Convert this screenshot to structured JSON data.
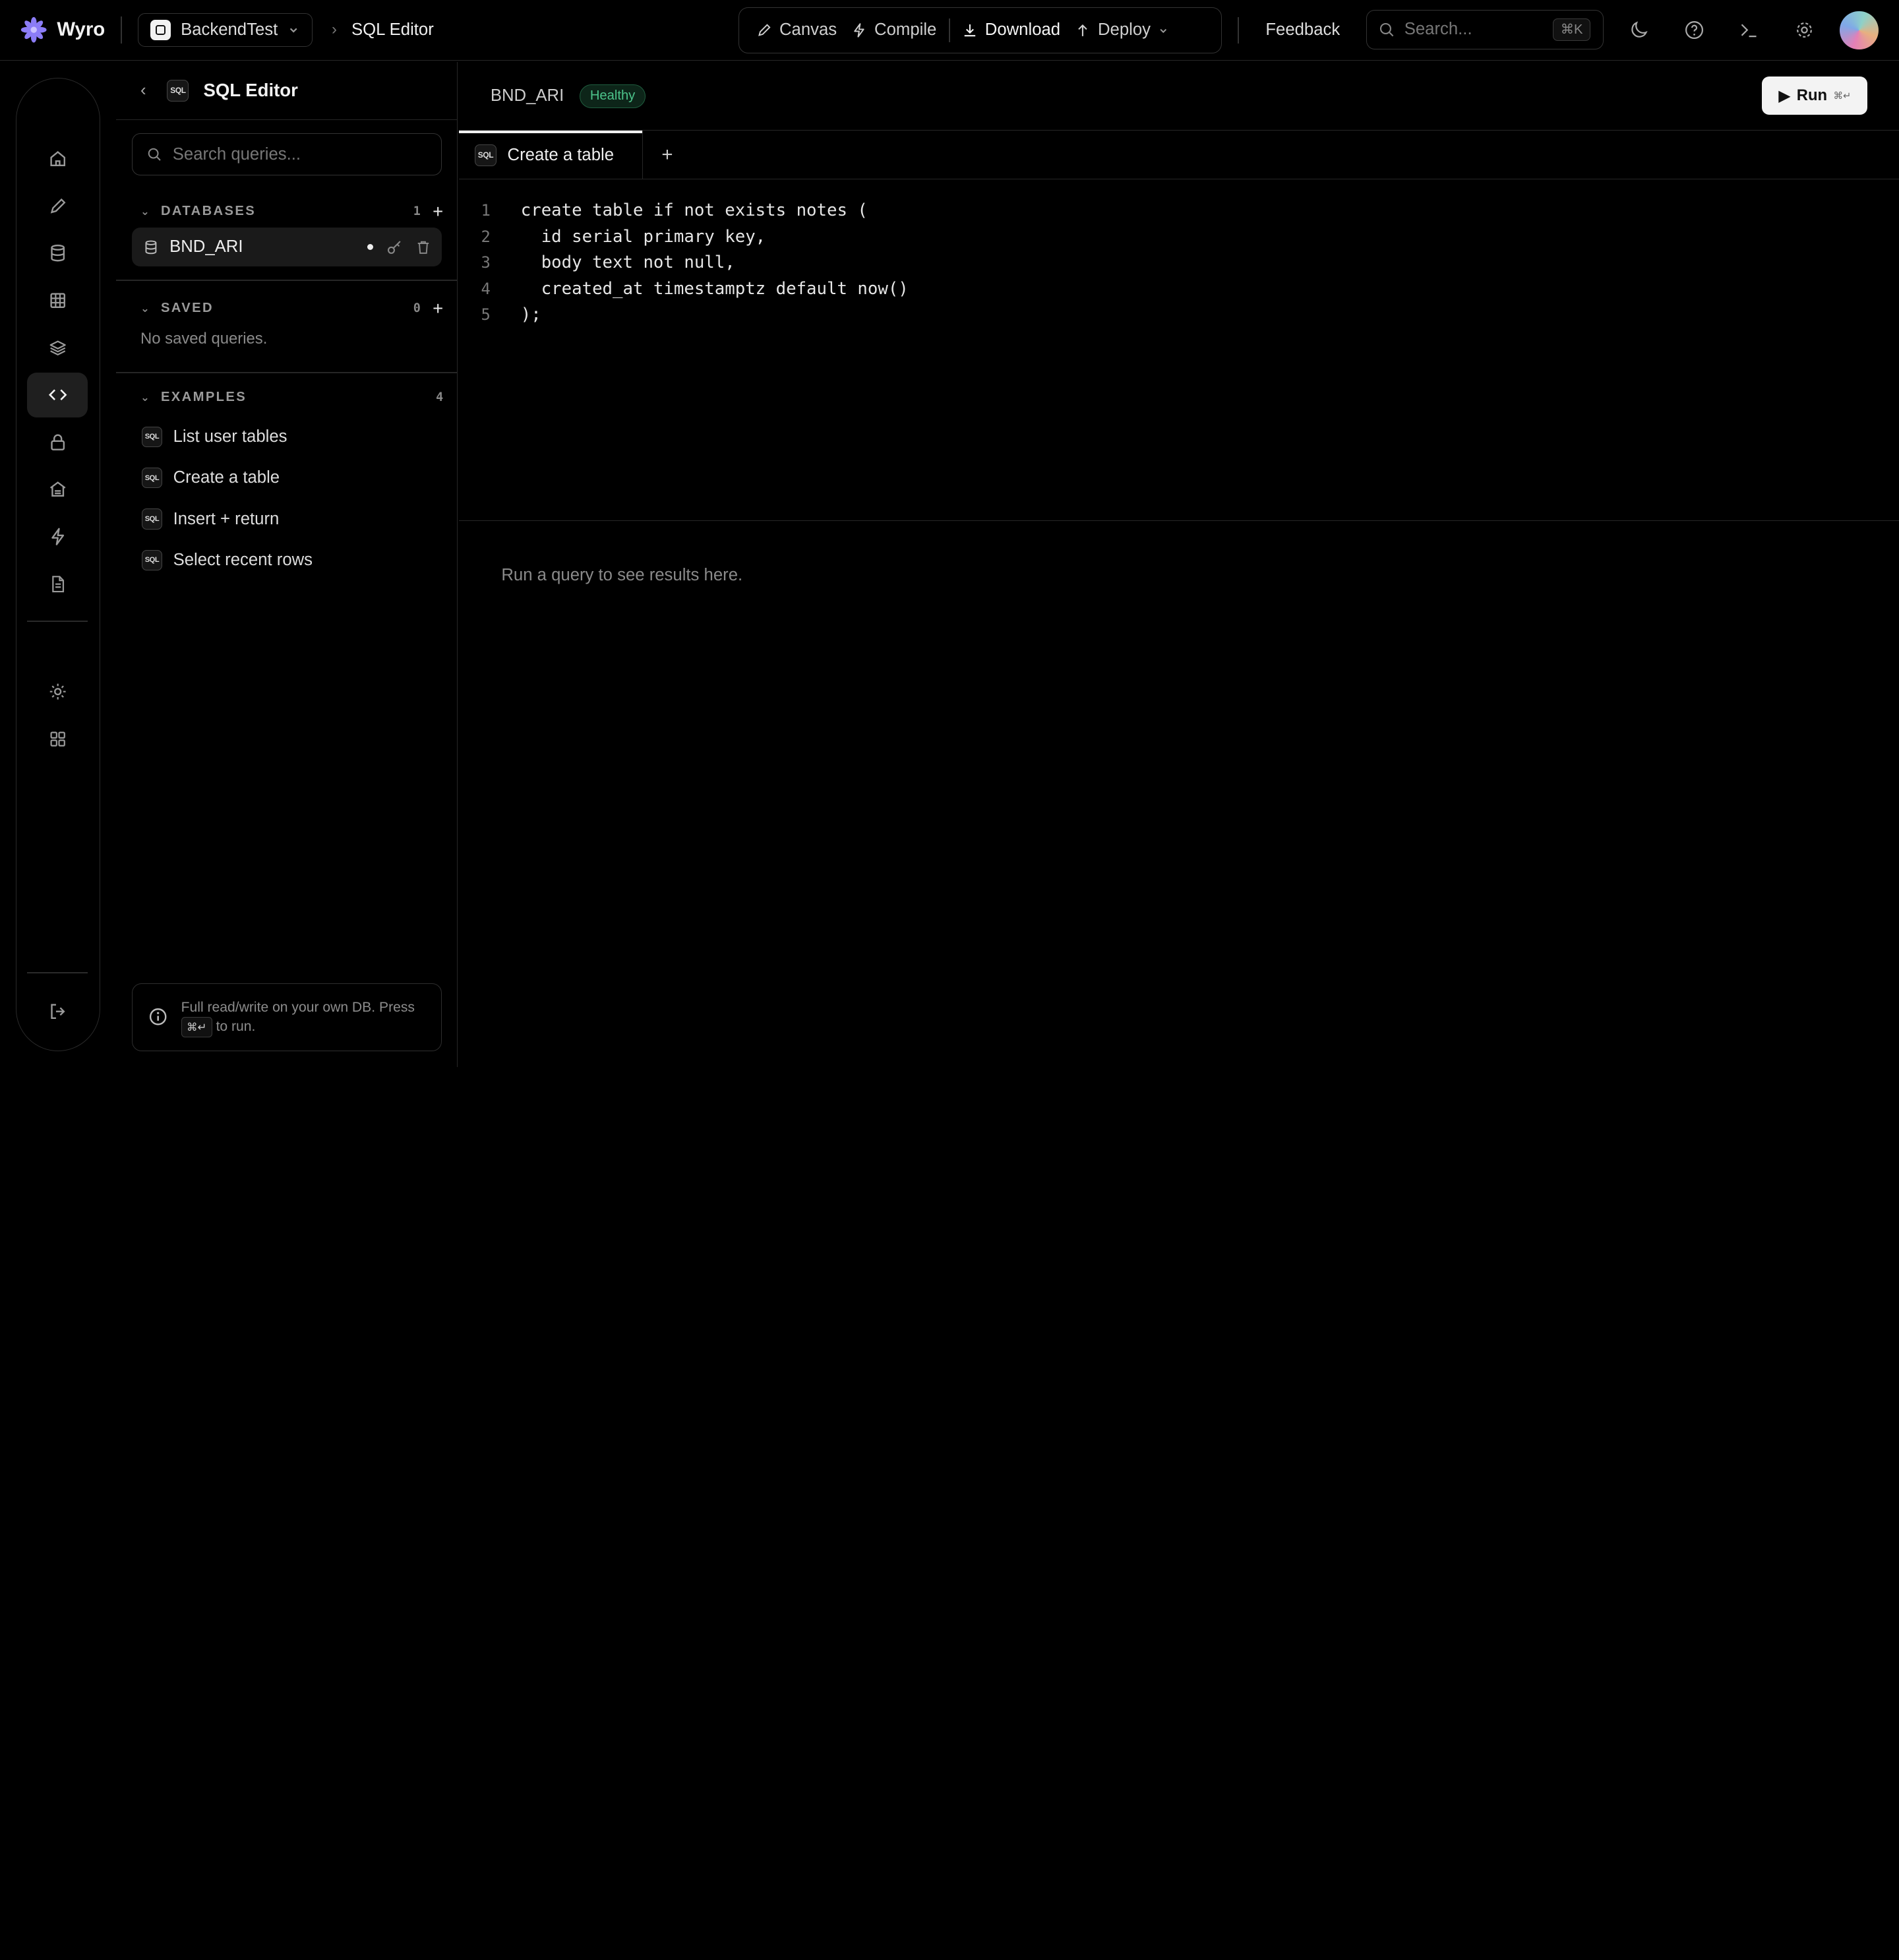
{
  "app": {
    "name": "Wyro"
  },
  "header": {
    "project": "BackendTest",
    "crumb": "SQL Editor",
    "tools": {
      "canvas": "Canvas",
      "compile": "Compile",
      "download": "Download",
      "deploy": "Deploy"
    },
    "feedback": "Feedback",
    "search_placeholder": "Search...",
    "search_shortcut": "⌘K"
  },
  "sidebar": {
    "title": "SQL Editor",
    "sql_badge": "SQL",
    "search_placeholder": "Search queries...",
    "databases": {
      "label": "DATABASES",
      "count": "1",
      "items": [
        {
          "name": "BND_ARI"
        }
      ]
    },
    "saved": {
      "label": "SAVED",
      "count": "0",
      "empty": "No saved queries."
    },
    "examples": {
      "label": "EXAMPLES",
      "count": "4",
      "items": [
        {
          "label": "List user tables"
        },
        {
          "label": "Create a table"
        },
        {
          "label": "Insert + return"
        },
        {
          "label": "Select recent rows"
        }
      ]
    },
    "tip": {
      "text_before": "Full read/write on your own DB. Press",
      "key": "⌘↵",
      "text_after": "to run."
    }
  },
  "main": {
    "db_name": "BND_ARI",
    "status": "Healthy",
    "run_label": "Run",
    "run_shortcut": "⌘↵",
    "tab_label": "Create a table",
    "tab_add": "+",
    "code_lines": [
      "create table if not exists notes (",
      "  id serial primary key,",
      "  body text not null,",
      "  created_at timestamptz default now()",
      ");"
    ],
    "line_numbers": [
      "1",
      "2",
      "3",
      "4",
      "5"
    ],
    "results_placeholder": "Run a query to see results here."
  },
  "colors": {
    "status_green": "#4cc38a",
    "background": "#000000"
  }
}
